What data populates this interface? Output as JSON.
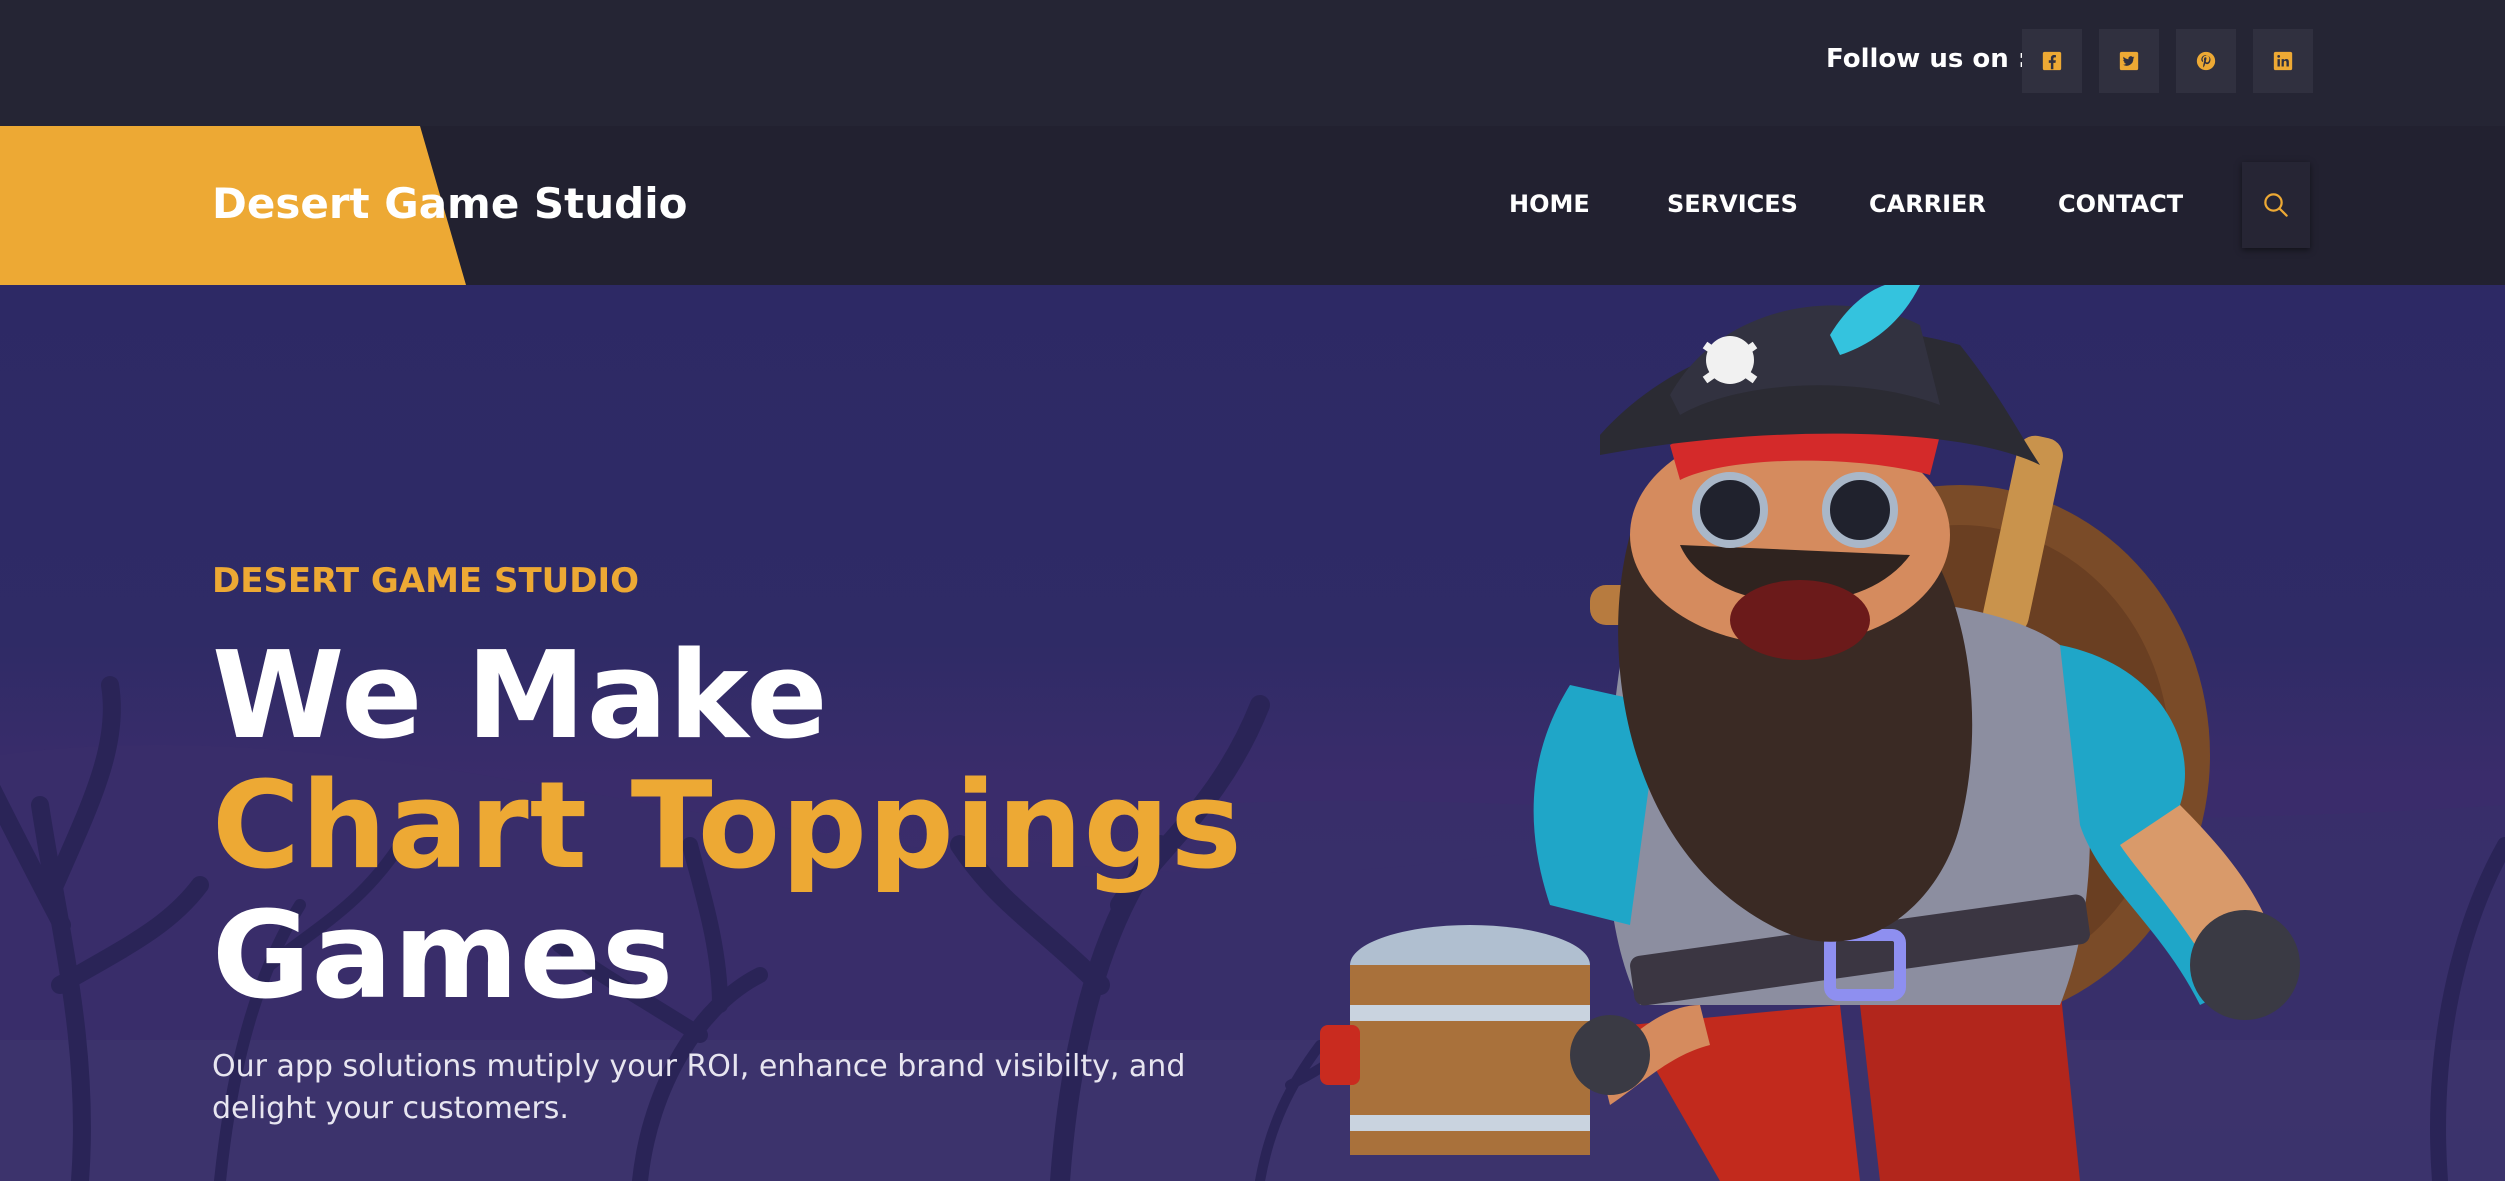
{
  "topbar": {
    "follow_label": "Follow us on :",
    "socials": [
      {
        "icon": "facebook-icon"
      },
      {
        "icon": "twitter-icon"
      },
      {
        "icon": "pinterest-icon"
      },
      {
        "icon": "linkedin-icon"
      }
    ]
  },
  "header": {
    "logo": "Desert Game Studio",
    "nav": [
      "HOME",
      "SERVICES",
      "CARRIER",
      "CONTACT"
    ],
    "search_icon": "search-icon"
  },
  "hero": {
    "eyebrow": "DESERT GAME STUDIO",
    "headline_line1": "We Make",
    "headline_line2": "Chart Toppings",
    "headline_line3": "Games",
    "subtitle": "Our app solutions mutiply your ROI, enhance brand visibilty, and delight your customers.",
    "image": "pirate-character-illustration"
  },
  "colors": {
    "accent": "#eda934",
    "topbar_bg": "#252534",
    "nav_bg": "#222130",
    "hero_bg": "#2d2965",
    "text_white": "#ffffff"
  }
}
